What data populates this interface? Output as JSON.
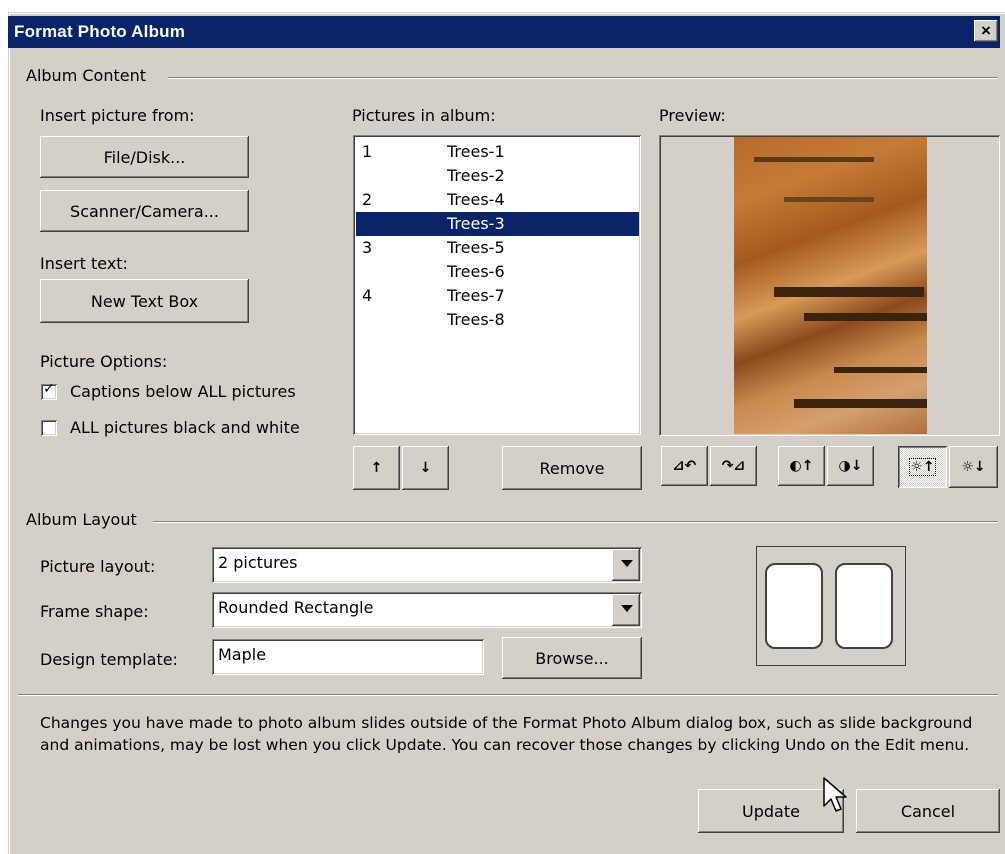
{
  "window": {
    "title": "Format Photo Album",
    "close_label": "×"
  },
  "album_content": {
    "group_label": "Album Content",
    "insert_picture_label": "Insert picture from:",
    "file_disk_button": "File/Disk...",
    "scanner_camera_button": "Scanner/Camera...",
    "insert_text_label": "Insert text:",
    "new_text_box_button": "New Text Box",
    "picture_options_label": "Picture Options:",
    "captions_option": {
      "label": "Captions below ALL pictures",
      "checked": true
    },
    "black_white_option": {
      "label": "ALL pictures black and white",
      "checked": false
    },
    "pictures_label": "Pictures in album:",
    "pictures": [
      {
        "num": "1",
        "name": "Trees-1",
        "selected": false
      },
      {
        "num": "",
        "name": "Trees-2",
        "selected": false
      },
      {
        "num": "2",
        "name": "Trees-4",
        "selected": false
      },
      {
        "num": "",
        "name": "Trees-3",
        "selected": true
      },
      {
        "num": "3",
        "name": "Trees-5",
        "selected": false
      },
      {
        "num": "",
        "name": "Trees-6",
        "selected": false
      },
      {
        "num": "4",
        "name": "Trees-7",
        "selected": false
      },
      {
        "num": "",
        "name": "Trees-8",
        "selected": false
      }
    ],
    "move_up_label": "↑",
    "move_down_label": "↓",
    "remove_button": "Remove",
    "preview_label": "Preview:",
    "preview_tools": [
      {
        "icon": "rotate-left-icon",
        "glyph": "⊿↶"
      },
      {
        "icon": "rotate-right-icon",
        "glyph": "↷⊿"
      },
      {
        "icon": "more-contrast-icon",
        "glyph": "◐↑"
      },
      {
        "icon": "less-contrast-icon",
        "glyph": "◑↓"
      },
      {
        "icon": "more-brightness-icon",
        "glyph": "☼↑"
      },
      {
        "icon": "less-brightness-icon",
        "glyph": "☼↓"
      }
    ]
  },
  "album_layout": {
    "group_label": "Album Layout",
    "picture_layout_label": "Picture layout:",
    "picture_layout_value": "2 pictures",
    "frame_shape_label": "Frame shape:",
    "frame_shape_value": "Rounded Rectangle",
    "design_template_label": "Design template:",
    "design_template_value": "Maple",
    "browse_button": "Browse..."
  },
  "notice": "Changes you have made to photo album slides outside of the Format Photo Album dialog box, such as slide background and animations, may be lost when you click Update. You can recover those changes by clicking Undo on the Edit menu.",
  "footer": {
    "update_button": "Update",
    "cancel_button": "Cancel"
  },
  "colors": {
    "title_bar": "#0a246a",
    "dialog_face": "#d4d0c8",
    "selection": "#0a246a"
  }
}
